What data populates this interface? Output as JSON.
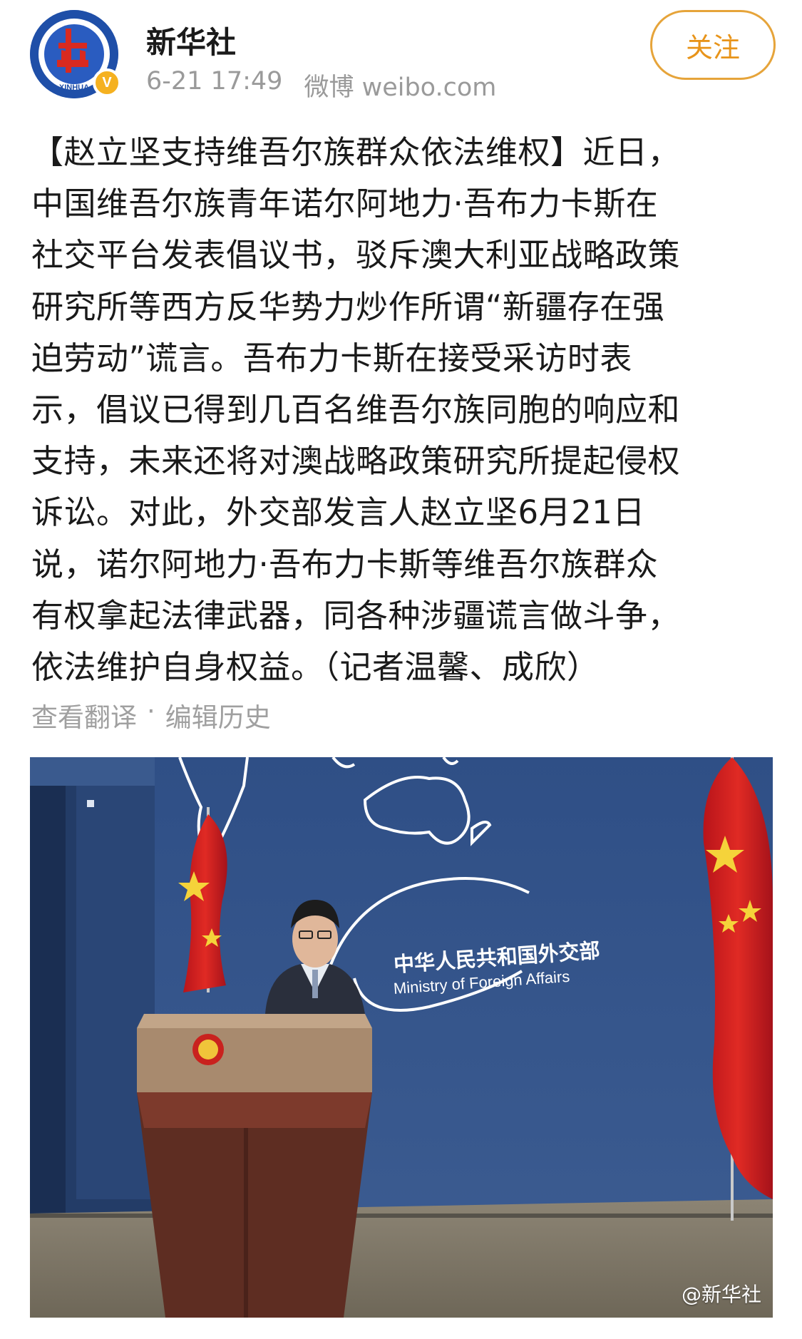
{
  "account": {
    "name": "新华社",
    "timestamp": "6-21 17:49",
    "source": "微博 weibo.com",
    "avatar_text": "XINHUA",
    "verified_mark": "V",
    "follow_label": "关注"
  },
  "post": {
    "lines": [
      "【赵立坚支持维吾尔族群众依法维权】近日，",
      "中国维吾尔族青年诺尔阿地力·吾布力卡斯在",
      "社交平台发表倡议书，驳斥澳大利亚战略政策",
      "研究所等西方反华势力炒作所谓“新疆存在强",
      "迫劳动”谎言。吾布力卡斯在接受采访时表",
      "示，倡议已得到几百名维吾尔族同胞的响应和",
      "支持，未来还将对澳战略政策研究所提起侵权",
      "诉讼。对此，外交部发言人赵立坚6月21日",
      "说，诺尔阿地力·吾布力卡斯等维吾尔族群众",
      "有权拿起法律武器，同各种涉疆谎言做斗争，",
      "依法维护自身权益。（记者温馨、成欣）"
    ]
  },
  "tools": {
    "translate": "查看翻译",
    "separator": "·",
    "edit_history": "编辑历史"
  },
  "image": {
    "backdrop_cn": "中华人民共和国外交部",
    "backdrop_en": "Ministry of Foreign Affairs",
    "watermark": "@新华社"
  }
}
